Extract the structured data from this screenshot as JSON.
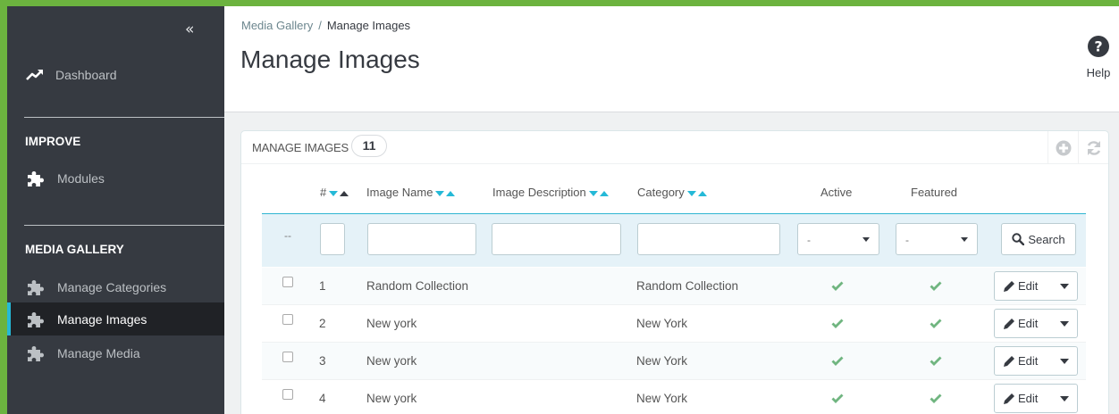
{
  "sidebar": {
    "collapse_icon": "«",
    "dashboard": "Dashboard",
    "improve_title": "IMPROVE",
    "modules": "Modules",
    "media_gallery_title": "MEDIA GALLERY",
    "items": [
      {
        "label": "Manage Categories",
        "icon": "puzzle-icon"
      },
      {
        "label": "Manage Images",
        "icon": "puzzle-icon",
        "active": true
      },
      {
        "label": "Manage Media",
        "icon": "puzzle-icon"
      }
    ]
  },
  "header": {
    "breadcrumb": {
      "parent": "Media Gallery",
      "separator": "/",
      "current": "Manage Images"
    },
    "title": "Manage Images",
    "help_label": "Help"
  },
  "panel": {
    "title": "MANAGE IMAGES",
    "count": "11",
    "columns": {
      "id": "#",
      "name": "Image Name",
      "description": "Image Description",
      "category": "Category",
      "active": "Active",
      "featured": "Featured"
    },
    "filters": {
      "dash": "--",
      "active_value": "-",
      "featured_value": "-",
      "search_label": "Search"
    },
    "rows": [
      {
        "id": "1",
        "name": "Random Collection",
        "description": "",
        "category": "Random Collection",
        "active": true,
        "featured": true,
        "action": "Edit"
      },
      {
        "id": "2",
        "name": "New york",
        "description": "",
        "category": "New York",
        "active": true,
        "featured": true,
        "action": "Edit"
      },
      {
        "id": "3",
        "name": "New york",
        "description": "",
        "category": "New York",
        "active": true,
        "featured": true,
        "action": "Edit"
      },
      {
        "id": "4",
        "name": "New york",
        "description": "",
        "category": "New York",
        "active": true,
        "featured": true,
        "action": "Edit"
      }
    ]
  },
  "colors": {
    "outer_border": "#6cb33f",
    "sidebar_bg": "#363a41",
    "active_item_bg": "#202226",
    "accent": "#25b9d7",
    "check_green": "#70b580"
  }
}
